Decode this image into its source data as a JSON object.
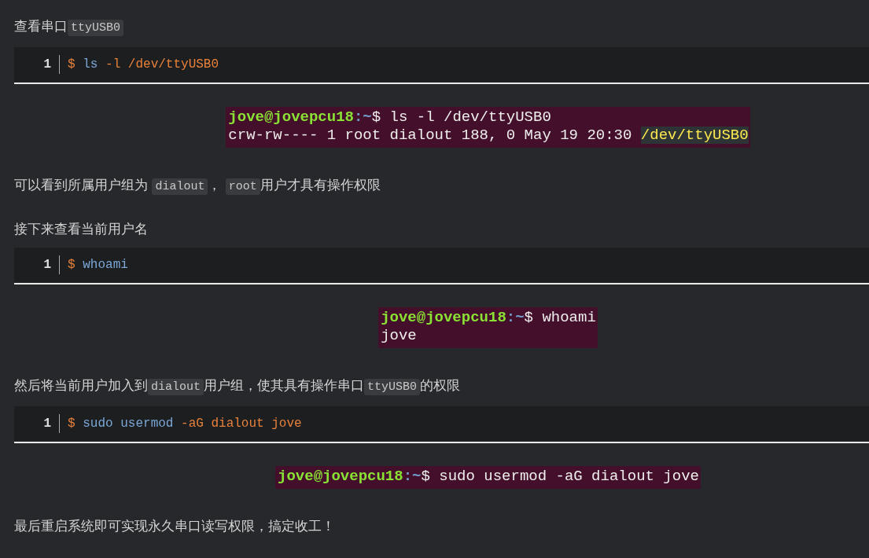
{
  "blocks": [
    {
      "kind": "paragraph",
      "parts": [
        {
          "kind": "text",
          "text": "查看串口"
        },
        {
          "kind": "code",
          "text": "ttyUSB0"
        }
      ]
    },
    {
      "kind": "code",
      "line_number": "1",
      "tokens": [
        {
          "kind": "symbol",
          "text": "$"
        },
        {
          "kind": "command",
          "text": "ls"
        },
        {
          "kind": "symbol",
          "text": "-l /dev/ttyUSB0"
        }
      ]
    },
    {
      "kind": "terminal",
      "lines": [
        [
          {
            "kind": "user",
            "text": "jove@jovepcu18"
          },
          {
            "kind": "path",
            "text": ":~"
          },
          {
            "kind": "plain",
            "text": "$ ls -l /dev/ttyUSB0"
          }
        ],
        [
          {
            "kind": "plain",
            "text": "crw-rw---- 1 root dialout 188, 0 May 19 20:30 "
          },
          {
            "kind": "highlight",
            "text": "/dev/ttyUSB0"
          }
        ]
      ]
    },
    {
      "kind": "paragraph",
      "parts": [
        {
          "kind": "text",
          "text": "可以看到所属用户组为 "
        },
        {
          "kind": "code",
          "text": "dialout"
        },
        {
          "kind": "text",
          "text": "， "
        },
        {
          "kind": "code",
          "text": "root"
        },
        {
          "kind": "text",
          "text": "用户才具有操作权限"
        }
      ]
    },
    {
      "kind": "paragraph",
      "parts": [
        {
          "kind": "text",
          "text": "接下来查看当前用户名"
        }
      ]
    },
    {
      "kind": "code",
      "line_number": "1",
      "tokens": [
        {
          "kind": "symbol",
          "text": "$"
        },
        {
          "kind": "command",
          "text": "whoami"
        }
      ]
    },
    {
      "kind": "terminal",
      "lines": [
        [
          {
            "kind": "user",
            "text": "jove@jovepcu18"
          },
          {
            "kind": "path",
            "text": ":~"
          },
          {
            "kind": "plain",
            "text": "$ whoami"
          }
        ],
        [
          {
            "kind": "plain",
            "text": "jove"
          }
        ]
      ]
    },
    {
      "kind": "paragraph",
      "parts": [
        {
          "kind": "text",
          "text": "然后将当前用户加入到"
        },
        {
          "kind": "code",
          "text": "dialout"
        },
        {
          "kind": "text",
          "text": "用户组，使其具有操作串口"
        },
        {
          "kind": "code",
          "text": "ttyUSB0"
        },
        {
          "kind": "text",
          "text": "的权限"
        }
      ]
    },
    {
      "kind": "code",
      "line_number": "1",
      "tokens": [
        {
          "kind": "symbol",
          "text": "$"
        },
        {
          "kind": "command",
          "text": "sudo usermod"
        },
        {
          "kind": "symbol",
          "text": "-aG dialout jove"
        }
      ]
    },
    {
      "kind": "terminal",
      "lines": [
        [
          {
            "kind": "user",
            "text": "jove@jovepcu18"
          },
          {
            "kind": "path",
            "text": ":~"
          },
          {
            "kind": "plain",
            "text": "$ sudo usermod -aG dialout jove"
          }
        ]
      ]
    },
    {
      "kind": "paragraph",
      "parts": [
        {
          "kind": "text",
          "text": "最后重启系统即可实现永久串口读写权限，搞定收工！"
        }
      ]
    }
  ]
}
